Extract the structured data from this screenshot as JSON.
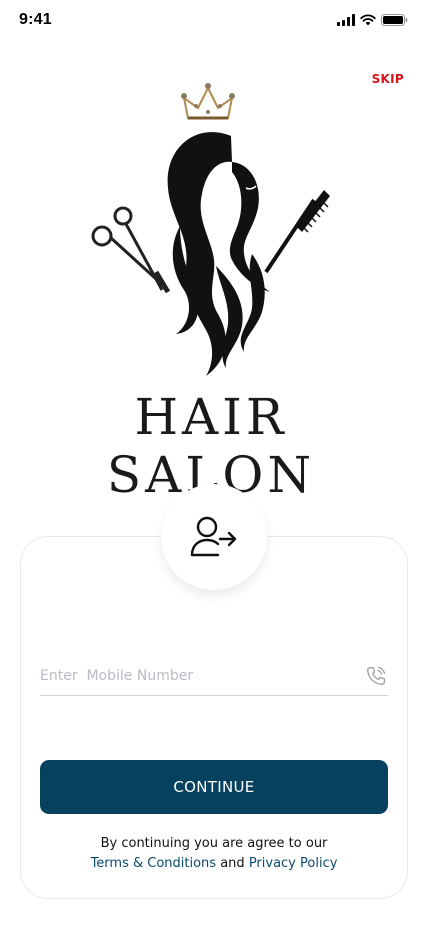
{
  "status_bar": {
    "time": "9:41"
  },
  "skip_label": "SKIP",
  "logo": {
    "brand_text": "HAIR SALON"
  },
  "login_card": {
    "mobile_placeholder": "Enter  Mobile Number",
    "mobile_value": "",
    "continue_label": "CONTINUE",
    "terms_prefix": "By continuing you are agree to our",
    "terms_link": "Terms & Conditions",
    "terms_and": "and",
    "privacy_link": "Privacy Policy"
  },
  "colors": {
    "primary": "#06415f",
    "skip": "#d7141b",
    "link": "#0b4a6e"
  },
  "icons": [
    "signal-icon",
    "wifi-icon",
    "battery-icon",
    "user-login-icon",
    "phone-icon"
  ]
}
